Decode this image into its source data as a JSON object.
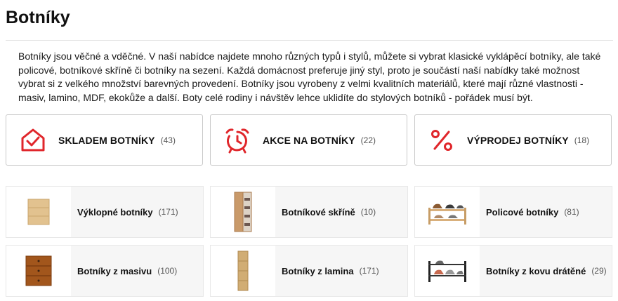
{
  "page": {
    "title": "Botníky",
    "intro": "Botníky jsou věčné a vděčné. V naší nabídce najdete mnoho různých typů i stylů, můžete si vybrat klasické vyklápěcí botníky, ale také policové, botníkové skříně či botníky na sezení. Každá domácnost preferuje jiný styl, proto je součástí naší nabídky také možnost vybrat si z velkého množství barevných provedení. Botníky jsou vyrobeny z velmi kvalitních materiálů, které mají různé vlastnosti - masiv, lamino, MDF, ekokůže a další. Boty celé rodiny i návštěv lehce uklidíte do stylových botníků - pořádek musí být."
  },
  "colors": {
    "accent": "#e0262b",
    "border": "#c9c9c9",
    "tile_bg": "#f6f6f6"
  },
  "promos": [
    {
      "label": "SKLADEM BOTNÍKY",
      "count": "(43)",
      "icon": "house-check-icon"
    },
    {
      "label": "AKCE NA BOTNÍKY",
      "count": "(22)",
      "icon": "alarm-clock-icon"
    },
    {
      "label": "VÝPRODEJ BOTNÍKY",
      "count": "(18)",
      "icon": "percent-icon"
    }
  ],
  "categories": [
    {
      "name": "Výklopné botníky",
      "count": "(171)",
      "icon": "tilting-shoe-cabinet-image"
    },
    {
      "name": "Botníkové skříně",
      "count": "(10)",
      "icon": "shoe-wardrobe-image"
    },
    {
      "name": "Policové botníky",
      "count": "(81)",
      "icon": "shelf-shoe-rack-image"
    },
    {
      "name": "Botníky z masivu",
      "count": "(100)",
      "icon": "solid-wood-cabinet-image"
    },
    {
      "name": "Botníky z lamina",
      "count": "(171)",
      "icon": "laminate-cabinet-image"
    },
    {
      "name": "Botníky z kovu drátěné",
      "count": "(29)",
      "icon": "wire-metal-rack-image"
    }
  ]
}
